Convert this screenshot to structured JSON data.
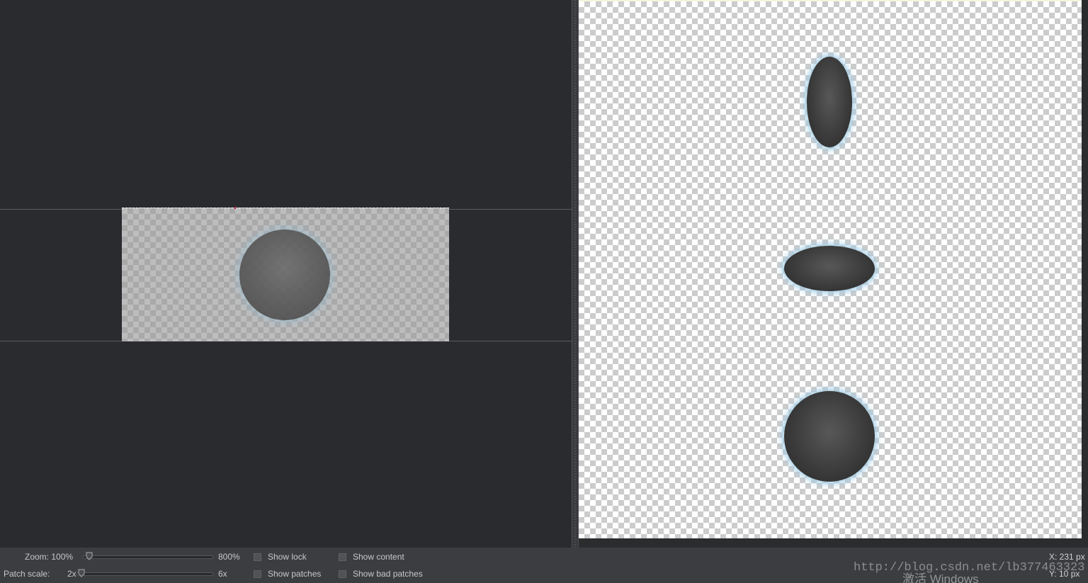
{
  "controls": {
    "zoom_label": "Zoom: 100%",
    "zoom_max": "800%",
    "zoom_level_percent": 100,
    "patch_scale_label": "Patch scale:",
    "patch_scale_min": "2x",
    "patch_scale_max": "6x",
    "patch_scale_value": 2,
    "checkboxes": {
      "show_lock": "Show lock",
      "show_content": "Show content",
      "show_patches": "Show patches",
      "show_bad_patches": "Show bad patches"
    }
  },
  "status": {
    "x_readout": "X: 231 px",
    "y_readout": "Y:  10 px"
  },
  "overlay": {
    "watermark": "http://blog.csdn.net/lb377463323",
    "activate_windows": "激活 Windows"
  },
  "colors": {
    "canvas_bg": "#2a2b2e",
    "glow": "#a0cde6",
    "patch_marker": "#c0233a"
  }
}
